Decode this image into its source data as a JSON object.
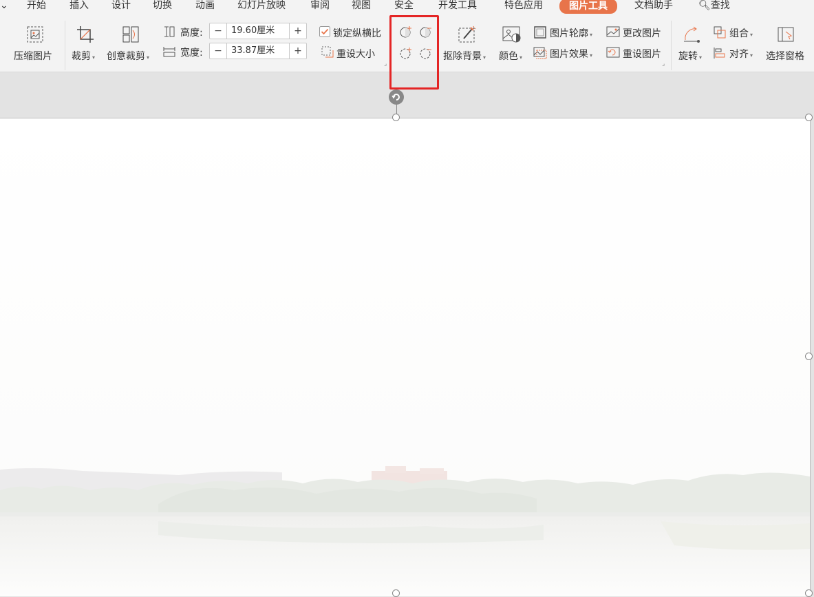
{
  "menubar": {
    "items": [
      "开始",
      "插入",
      "设计",
      "切换",
      "动画",
      "幻灯片放映",
      "审阅",
      "视图",
      "安全",
      "开发工具",
      "特色应用",
      "图片工具",
      "文档助手",
      "查找"
    ],
    "active": "图片工具"
  },
  "ribbon": {
    "compress": "压缩图片",
    "crop": "裁剪",
    "creative_crop": "创意裁剪",
    "height_label": "高度:",
    "height_value": "19.60厘米",
    "width_label": "宽度:",
    "width_value": "33.87厘米",
    "lock_ratio": "锁定纵横比",
    "reset_size": "重设大小",
    "remove_bg": "抠除背景",
    "color": "颜色",
    "picture_outline": "图片轮廓",
    "picture_effect": "图片效果",
    "change_picture": "更改图片",
    "reset_picture": "重设图片",
    "rotate": "旋转",
    "group": "组合",
    "align": "对齐",
    "selection_pane": "选择窗格"
  },
  "colors": {
    "accent": "#e8744a",
    "highlight": "#e42525"
  }
}
